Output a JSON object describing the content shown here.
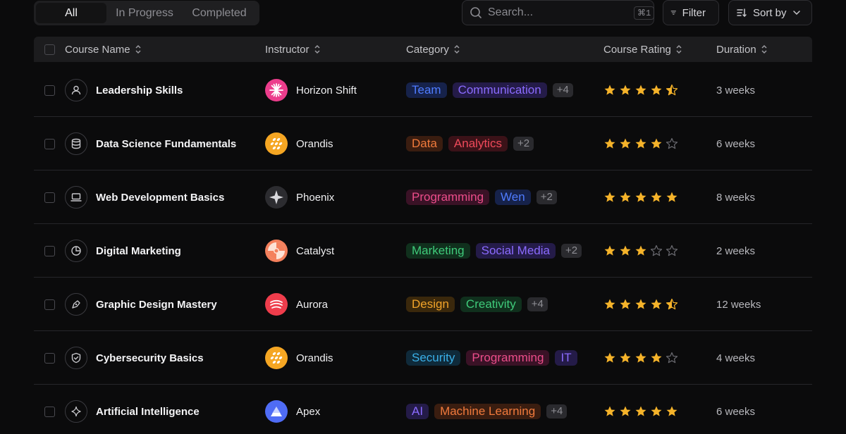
{
  "tabs": [
    {
      "label": "All",
      "active": true
    },
    {
      "label": "In Progress",
      "active": false
    },
    {
      "label": "Completed",
      "active": false
    }
  ],
  "search": {
    "placeholder": "Search...",
    "shortcut": "⌘1"
  },
  "filter_label": "Filter",
  "sort_label": "Sort by",
  "columns": [
    "Course Name",
    "Instructor",
    "Category",
    "Course Rating",
    "Duration"
  ],
  "colors": {
    "star": "#f5b32a",
    "star_empty": "#6a6a70"
  },
  "rows": [
    {
      "course": "Leadership Skills",
      "icon": "user-icon",
      "instructor": "Horizon Shift",
      "avatar": "horizon-shift-logo",
      "categories": [
        {
          "label": "Team",
          "fg": "#4f7cff",
          "bg": "#16224a"
        },
        {
          "label": "Communication",
          "fg": "#8b6bff",
          "bg": "#241b48"
        }
      ],
      "more": "+4",
      "rating": 4.5,
      "duration": "3 weeks"
    },
    {
      "course": "Data Science Fundamentals",
      "icon": "database-icon",
      "instructor": "Orandis",
      "avatar": "orandis-logo",
      "categories": [
        {
          "label": "Data",
          "fg": "#f07a3c",
          "bg": "#3a1d10"
        },
        {
          "label": "Analytics",
          "fg": "#ef4a5a",
          "bg": "#3b1218"
        }
      ],
      "more": "+2",
      "rating": 4,
      "duration": "6 weeks"
    },
    {
      "course": "Web Development Basics",
      "icon": "laptop-icon",
      "instructor": "Phoenix",
      "avatar": "phoenix-logo",
      "categories": [
        {
          "label": "Programming",
          "fg": "#ec4d8a",
          "bg": "#3a1226"
        },
        {
          "label": "Wen",
          "fg": "#4f7cff",
          "bg": "#16224a"
        }
      ],
      "more": "+2",
      "rating": 5,
      "duration": "8 weeks"
    },
    {
      "course": "Digital Marketing",
      "icon": "pie-chart-icon",
      "instructor": "Catalyst",
      "avatar": "catalyst-logo",
      "categories": [
        {
          "label": "Marketing",
          "fg": "#3fca7a",
          "bg": "#10301d"
        },
        {
          "label": "Social Media",
          "fg": "#8b6bff",
          "bg": "#241b48"
        }
      ],
      "more": "+2",
      "rating": 3,
      "duration": "2 weeks"
    },
    {
      "course": "Graphic Design Mastery",
      "icon": "pen-tool-icon",
      "instructor": "Aurora",
      "avatar": "aurora-logo",
      "categories": [
        {
          "label": "Design",
          "fg": "#f2a42a",
          "bg": "#3a280c"
        },
        {
          "label": "Creativity",
          "fg": "#3fca7a",
          "bg": "#10301d"
        }
      ],
      "more": "+4",
      "rating": 4.5,
      "duration": "12 weeks"
    },
    {
      "course": "Cybersecurity Basics",
      "icon": "shield-icon",
      "instructor": "Orandis",
      "avatar": "orandis-logo",
      "categories": [
        {
          "label": "Security",
          "fg": "#3ab0e8",
          "bg": "#0f2a3a"
        },
        {
          "label": "Programming",
          "fg": "#ec4d8a",
          "bg": "#3a1226"
        },
        {
          "label": "IT",
          "fg": "#8b6bff",
          "bg": "#241b48"
        }
      ],
      "more": "",
      "rating": 4,
      "duration": "4 weeks"
    },
    {
      "course": "Artificial Intelligence",
      "icon": "sparkle-icon",
      "instructor": "Apex",
      "avatar": "apex-logo",
      "categories": [
        {
          "label": "AI",
          "fg": "#8b6bff",
          "bg": "#241b48"
        },
        {
          "label": "Machine Learning",
          "fg": "#f07a3c",
          "bg": "#3a1d10"
        }
      ],
      "more": "+4",
      "rating": 5,
      "duration": "6 weeks"
    }
  ]
}
